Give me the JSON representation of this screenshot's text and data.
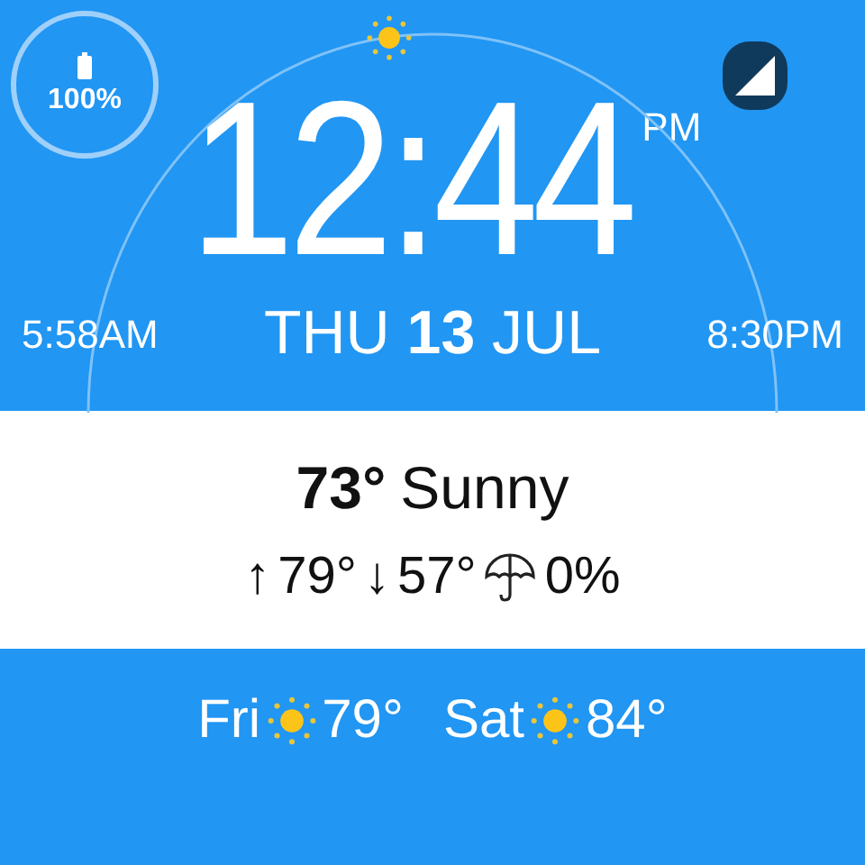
{
  "battery": {
    "percent": "100%"
  },
  "time": {
    "value": "12:44",
    "ampm": "PM"
  },
  "sunrise": "5:58AM",
  "date": "THU **13** JUL",
  "sunset": "8:30PM",
  "current": {
    "temp": "73°",
    "condition": "Sunny"
  },
  "today": {
    "high_arrow": "↑",
    "high": "79°",
    "low_arrow": "↓",
    "low": "57°",
    "precip": "0%"
  },
  "forecast": [
    {
      "day": "Fri",
      "temp": "79°"
    },
    {
      "day": "Sat",
      "temp": "84°"
    }
  ]
}
